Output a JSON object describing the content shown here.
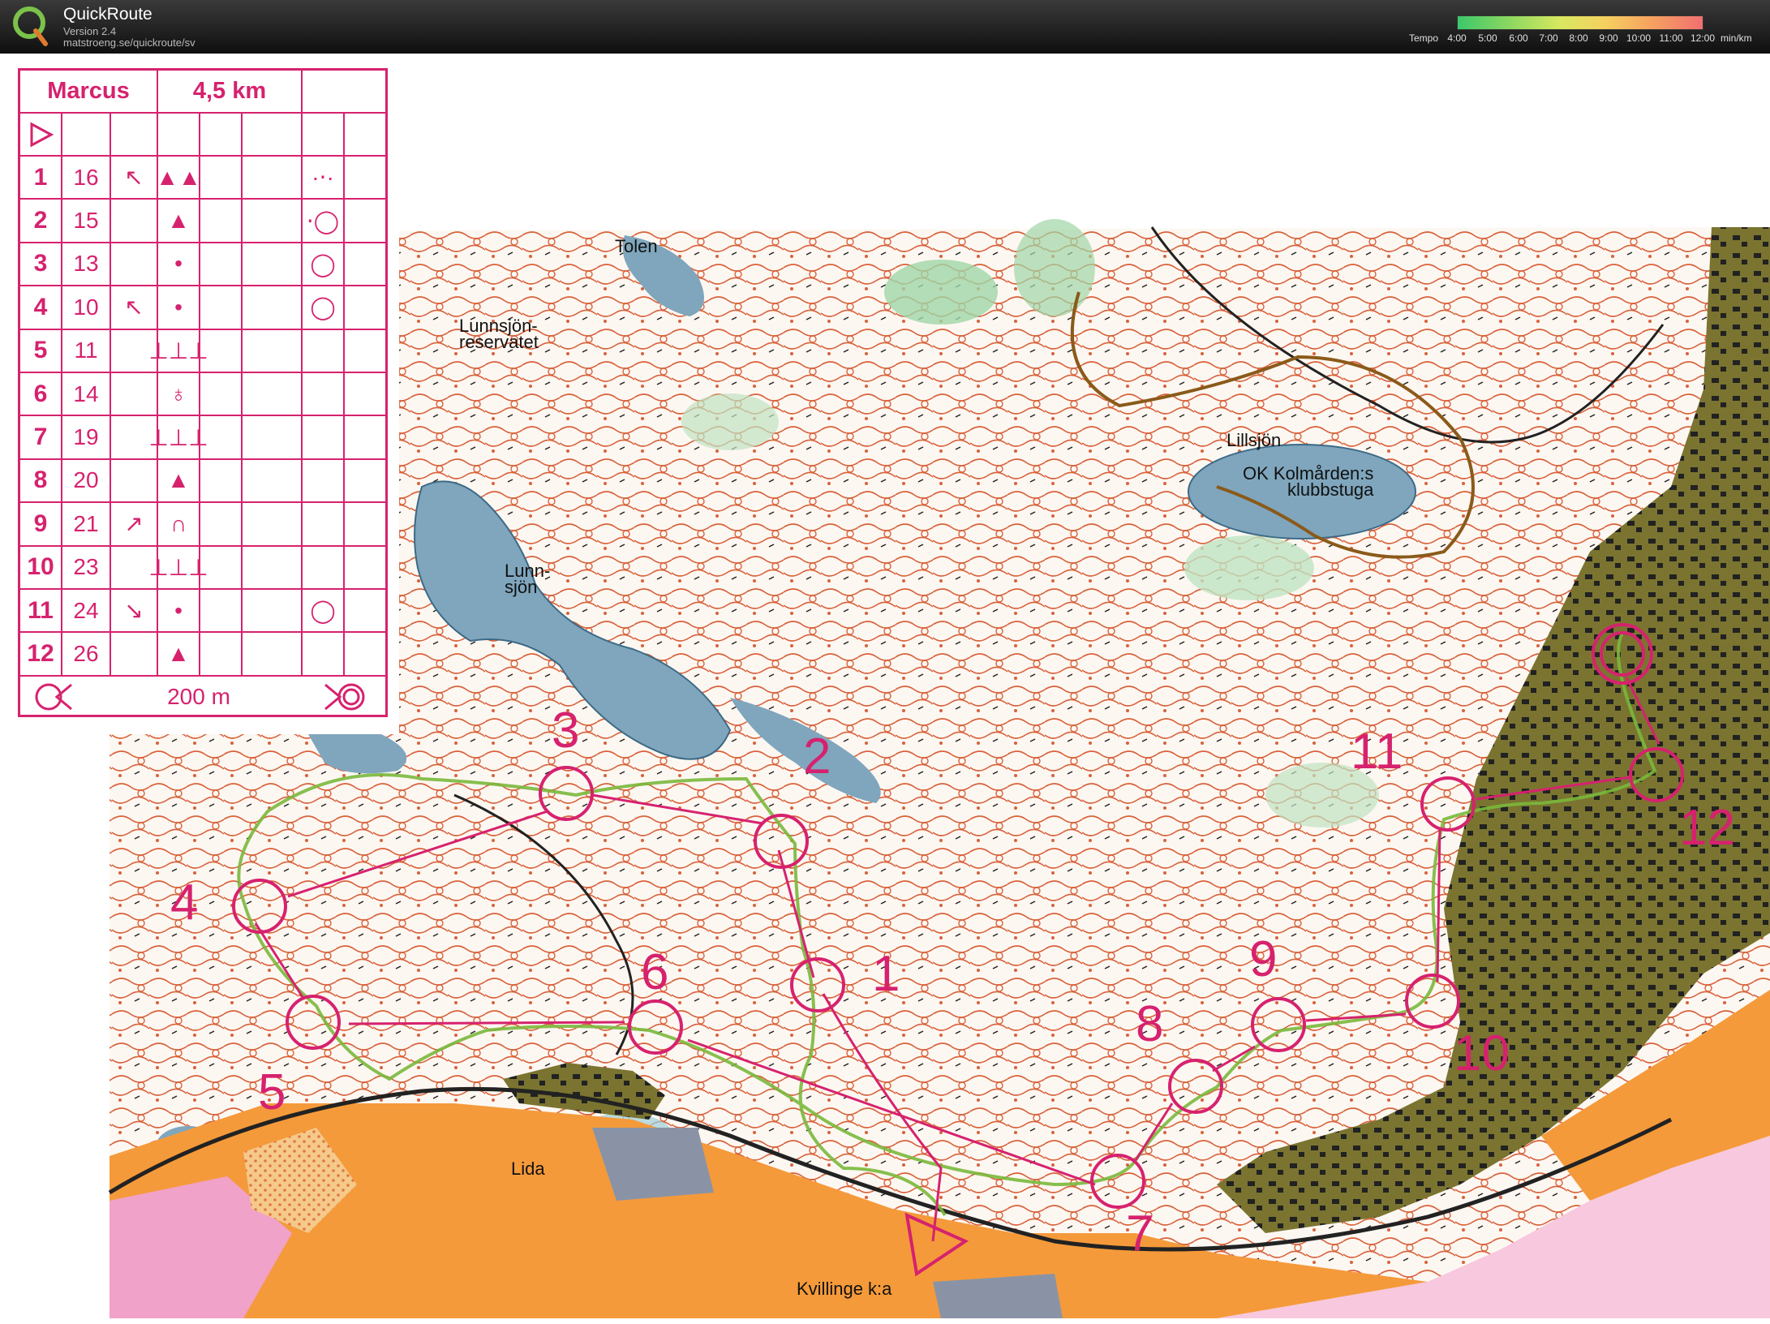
{
  "app": {
    "title": "QuickRoute",
    "version": "Version 2.4",
    "url": "matstroeng.se/quickroute/sv",
    "logo_icon": "quickroute-q-logo-icon"
  },
  "tempo": {
    "label": "Tempo",
    "ticks": [
      "4:00",
      "5:00",
      "6:00",
      "7:00",
      "8:00",
      "9:00",
      "10:00",
      "11:00",
      "12:00"
    ],
    "unit": "min/km"
  },
  "course": {
    "name": "Marcus",
    "length": "4,5 km",
    "finish_distance": "200 m",
    "controls": [
      {
        "number": "1",
        "code": "16",
        "dir": "↖",
        "feature": "▲▲",
        "detail": "·⋅·"
      },
      {
        "number": "2",
        "code": "15",
        "dir": "",
        "feature": "▲",
        "detail": "⋅◯"
      },
      {
        "number": "3",
        "code": "13",
        "dir": "",
        "feature": "•",
        "detail": "◯"
      },
      {
        "number": "4",
        "code": "10",
        "dir": "↖",
        "feature": "•",
        "detail": "◯"
      },
      {
        "number": "5",
        "code": "11",
        "dir": "",
        "feature": "⊥⊥⊥",
        "detail": ""
      },
      {
        "number": "6",
        "code": "14",
        "dir": "",
        "feature": "♁",
        "detail": ""
      },
      {
        "number": "7",
        "code": "19",
        "dir": "",
        "feature": "⊥⊥⊥",
        "detail": ""
      },
      {
        "number": "8",
        "code": "20",
        "dir": "",
        "feature": "▲",
        "detail": ""
      },
      {
        "number": "9",
        "code": "21",
        "dir": "↗",
        "feature": "∩",
        "detail": ""
      },
      {
        "number": "10",
        "code": "23",
        "dir": "",
        "feature": "⊥⊥⊥",
        "detail": ""
      },
      {
        "number": "11",
        "code": "24",
        "dir": "↘",
        "feature": "•",
        "detail": "◯"
      },
      {
        "number": "12",
        "code": "26",
        "dir": "",
        "feature": "▲",
        "detail": ""
      }
    ]
  },
  "map_labels": {
    "tolen": "Tolen",
    "reservat": "Lunnsjön-\nreservatet",
    "lunnsjon": "Lunn-\nsjön",
    "lillsjon": "Lillsjön",
    "klubbstuga": "OK Kolmården:s\nklubbstuga",
    "lida": "Lida",
    "kvillinge": "Kvillinge k:a"
  },
  "colors": {
    "course_magenta": "#d6226e",
    "contour_brown": "#d8623a",
    "field_orange": "#f59a3a",
    "lake_blue": "#7fa6bd",
    "settlement_olive": "#6f6a2a",
    "road_pink": "#ef7fb0"
  }
}
